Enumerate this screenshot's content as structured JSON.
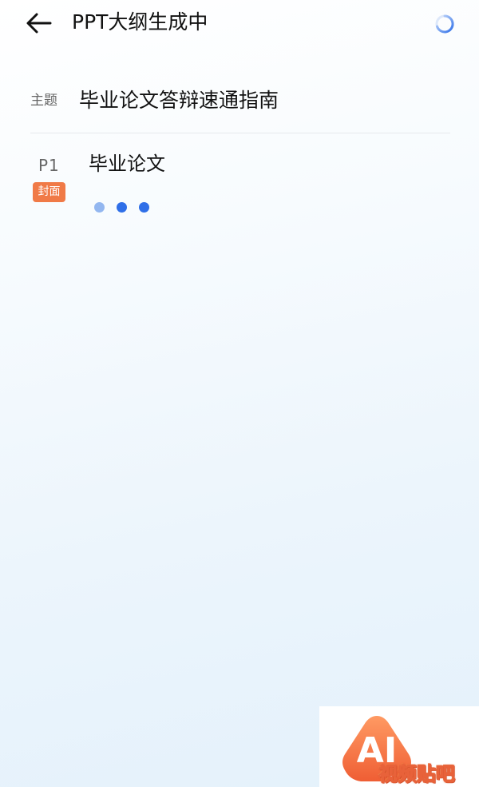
{
  "header": {
    "title": "PPT大纲生成中",
    "back_icon": "arrow-left-icon",
    "loading_icon": "loading-spinner-icon"
  },
  "topic": {
    "label": "主题",
    "value": "毕业论文答辩速通指南"
  },
  "pages": [
    {
      "number": "P1",
      "tag": "封面",
      "title": "毕业论文",
      "status": "generating"
    }
  ],
  "watermark": {
    "logo_text": "AI",
    "text": "视频贴吧"
  },
  "colors": {
    "text_primary": "#111111",
    "text_secondary": "#666666",
    "accent_blue": "#2f6fe8",
    "dot_light": "#93b7f0",
    "tag_orange": "#f07a47",
    "divider": "#e6e9ed",
    "watermark_orange": "#f06a3c"
  }
}
